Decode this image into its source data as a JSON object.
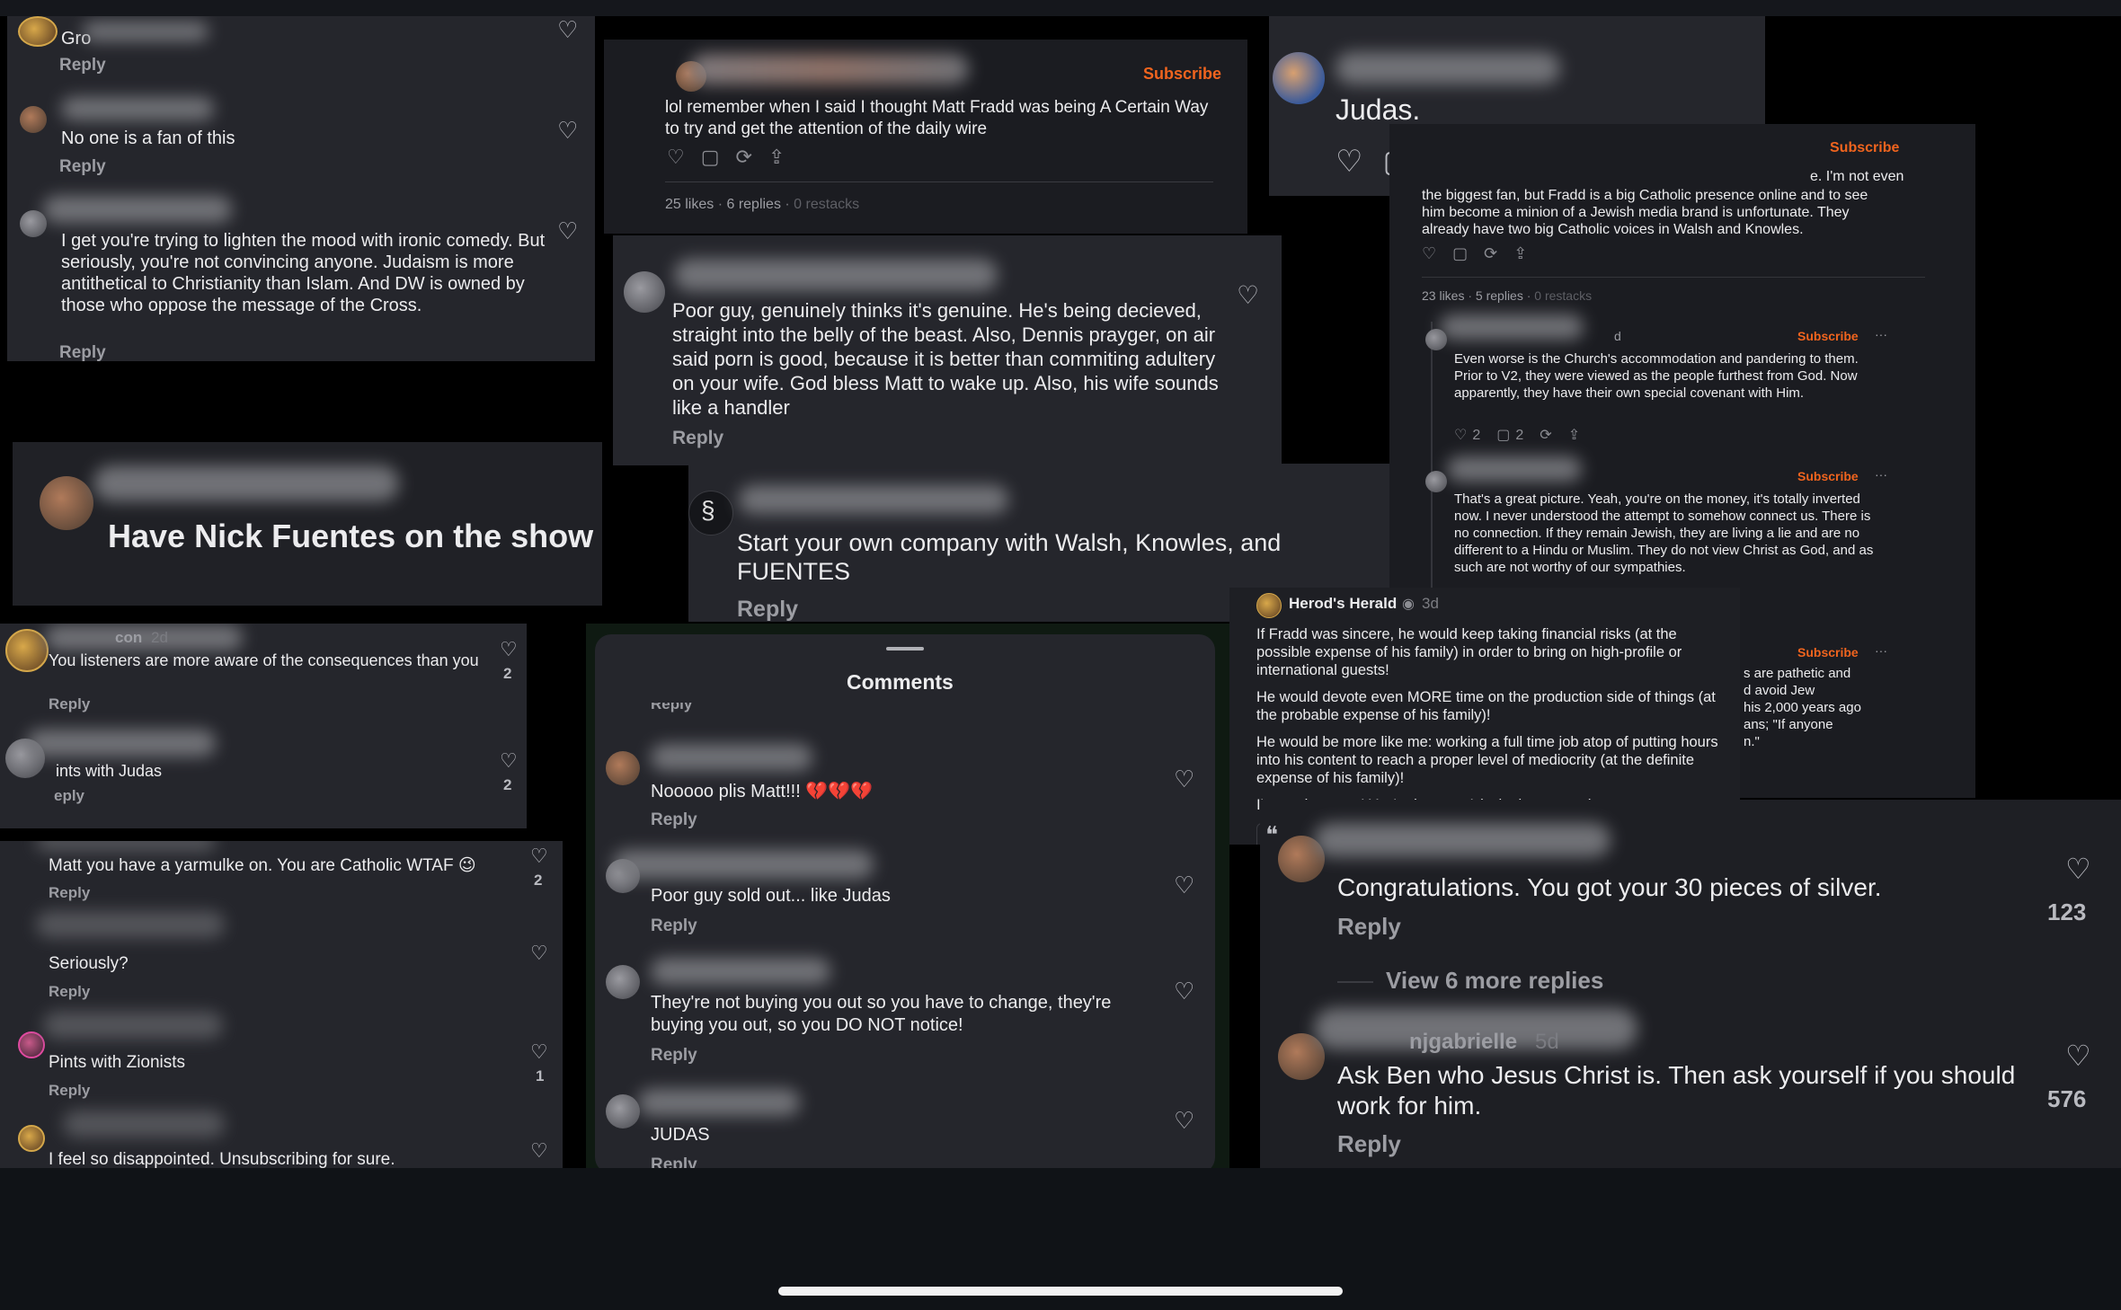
{
  "p1": {
    "c0_name": "Gro",
    "c0_reply": "Reply",
    "c1_text": "No one is a fan of this",
    "c1_reply": "Reply",
    "c2_text": "I get you're trying to lighten the mood with ironic comedy. But seriously, you're not convincing anyone. Judaism is more antithetical to Christianity than Islam. And DW is owned by those who oppose the message of the Cross.",
    "c2_reply": "Reply"
  },
  "p2": {
    "subscribe": "Subscribe",
    "text": "lol remember when I said I thought Matt Fradd was being A Certain Way to try and get the attention of the daily wire",
    "likes": "25 likes",
    "replies": "6 replies",
    "restacks": "0 restacks"
  },
  "p3": {
    "text": "Judas."
  },
  "p4": {
    "subscribe": "Subscribe",
    "top_text_tail": "e. I'm not even",
    "top_text": "the biggest fan, but Fradd is a big Catholic presence online and to see him become a minion of a Jewish media brand is unfortunate. They already have two big Catholic voices in Walsh and Knowles.",
    "likes": "23 likes",
    "replies": "5 replies",
    "restacks": "0 restacks",
    "r1_name_tail": "d",
    "r1_subscribe": "Subscribe",
    "r1_text": "Even worse is the Church's accommodation and pandering to them. Prior to V2, they were viewed as the people furthest from God. Now apparently, they have their own special covenant with Him.",
    "r1_likes": "2",
    "r1_comments": "2",
    "r2_subscribe": "Subscribe",
    "r2_text": "That's a great picture. Yeah, you're on the money, it's totally inverted now. I never understood the attempt to somehow connect us. There is no connection. If they remain Jewish, they are living a lie and are no different to a Hindu or Muslim. They do not view Christ as God, and as such are not worthy of our sympathies.",
    "r3_subscribe": "Subscribe",
    "r3_line1": "s are pathetic and",
    "r3_line2": "d avoid Jew",
    "r3_line3": "his 2,000 years ago",
    "r3_line4": "ans; \"If anyone",
    "r3_line5": "n.\""
  },
  "p5": {
    "text": "Poor guy, genuinely thinks it's genuine. He's being decieved, straight into the belly of the beast. Also, Dennis prayger, on air said porn is good, because it is better than commiting adultery on your wife. God bless Matt to wake up. Also, his wife sounds like a handler",
    "reply": "Reply"
  },
  "p6": {
    "text": "Have Nick Fuentes on the show"
  },
  "p7": {
    "text": "Start your own company with Walsh, Knowles, and FUENTES",
    "reply": "Reply"
  },
  "p8": {
    "name_tail": "con",
    "c1_time": "2d",
    "c1_text": "You listeners are more aware of the consequences than you",
    "c1_reply": "Reply",
    "c1_count": "2",
    "c2_text": "ints with Judas",
    "c2_reply": "eply",
    "c2_count": "2"
  },
  "p9": {
    "c1_text": "Matt you have a yarmulke on. You are Catholic WTAF 😉",
    "c1_reply": "Reply",
    "c1_count": "2",
    "c2_text": "Seriously?",
    "c2_reply": "Reply",
    "c3_text": "Pints with Zionists",
    "c3_reply": "Reply",
    "c3_count": "1",
    "c4_text": "I feel so disappointed. Unsubscribing for sure."
  },
  "p10": {
    "title": "Comments",
    "peek_reply": "Reply",
    "c1_text": "Nooooo plis Matt!!! 💔💔💔",
    "c1_reply": "Reply",
    "c2_text": "Poor guy sold out... like Judas",
    "c2_reply": "Reply",
    "c3_text": "They're not buying you out so you have to change, they're buying you out, so you DO NOT notice!",
    "c3_reply": "Reply",
    "c4_text": "JUDAS",
    "c4_reply": "Reply"
  },
  "p11": {
    "name": "Herod's Herald",
    "time": "3d",
    "para1": "If Fradd was sincere, he would keep taking financial risks (at the possible expense of his family) in order to bring on high-profile or international guests!",
    "para2": "He would devote even MORE time on the production side of things (at the probable expense of his family)!",
    "para3": "He would be more like me: working a full time job atop of putting hours into his content to reach a proper level of mediocrity (at the definite expense of his family)!",
    "para4": "I'm not insecure! You're insecure! (sobs in a corner)"
  },
  "p12": {
    "c1_text": "Congratulations. You got your 30 pieces of silver.",
    "c1_reply": "Reply",
    "c1_count": "123",
    "more": "View 6 more replies",
    "c2_name_tail": "njgabrielle",
    "c2_time": "5d",
    "c2_text": "Ask Ben who Jesus Christ is. Then ask yourself if you should work for him.",
    "c2_reply": "Reply",
    "c2_count": "576"
  },
  "icons": {
    "heart": "♡",
    "comment": "▢",
    "restack": "⟳",
    "share": "⇪",
    "more": "···"
  },
  "colors": {
    "accent": "#f0641e",
    "background": "#000000",
    "panel": "#25262c"
  }
}
